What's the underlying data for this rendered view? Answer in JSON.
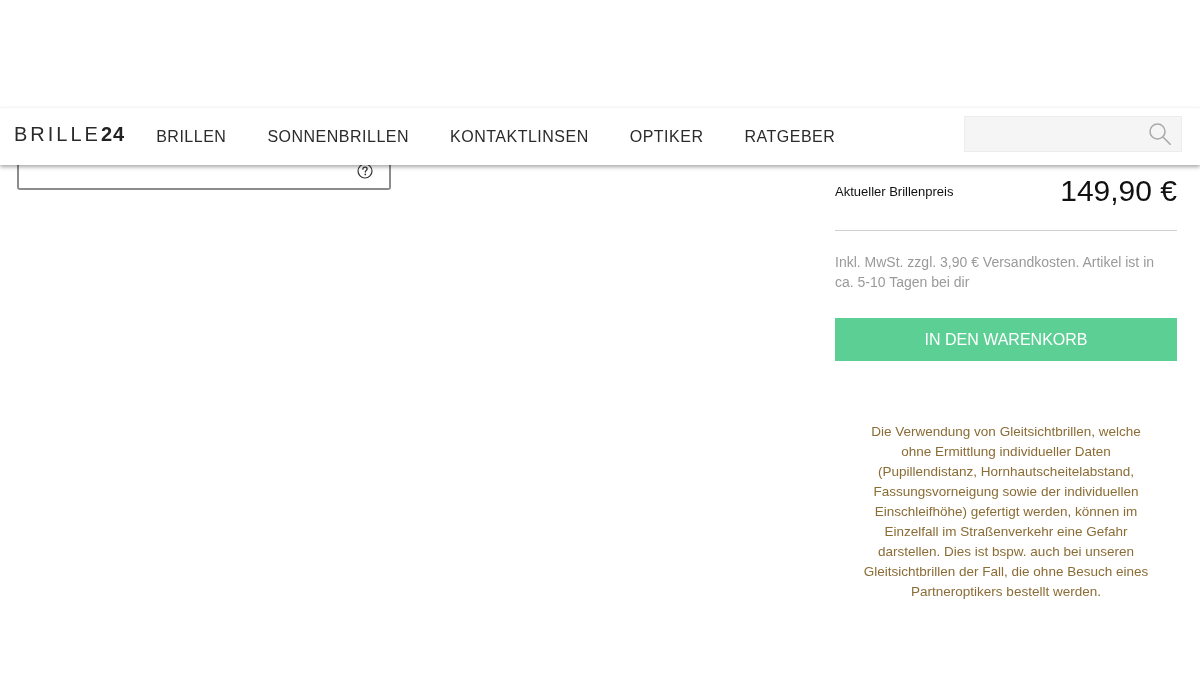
{
  "header": {
    "logo": "BRILLE**24**",
    "nav": [
      {
        "label": "BRILLEN"
      },
      {
        "label": "SONNENBRILLEN"
      },
      {
        "label": "KONTAKTLINSEN"
      },
      {
        "label": "OPTIKER"
      },
      {
        "label": "RATGEBER"
      }
    ]
  },
  "product": {
    "price_label": "Aktueller Brillenpreis",
    "price": "149,90 €",
    "shipping_note": "Inkl. MwSt. zzgl. 3,90 € Versandkosten. Artikel ist in ca. 5-10 Tagen bei dir",
    "cart_button": "IN DEN WARENKORB",
    "disclaimer": "Die Verwendung von Gleitsichtbrillen, welche ohne Ermittlung individueller Daten (Pupillendistanz, Hornhautscheitelabstand, Fassungsvorneigung sowie der individuellen Einschleifhöhe) gefertigt werden, können im Einzelfall im Straßenverkehr eine Gefahr darstellen. Dies ist bspw. auch bei unseren Gleitsichtbrillen der Fall, die ohne Besuch eines Partneroptikers bestellt werden."
  }
}
